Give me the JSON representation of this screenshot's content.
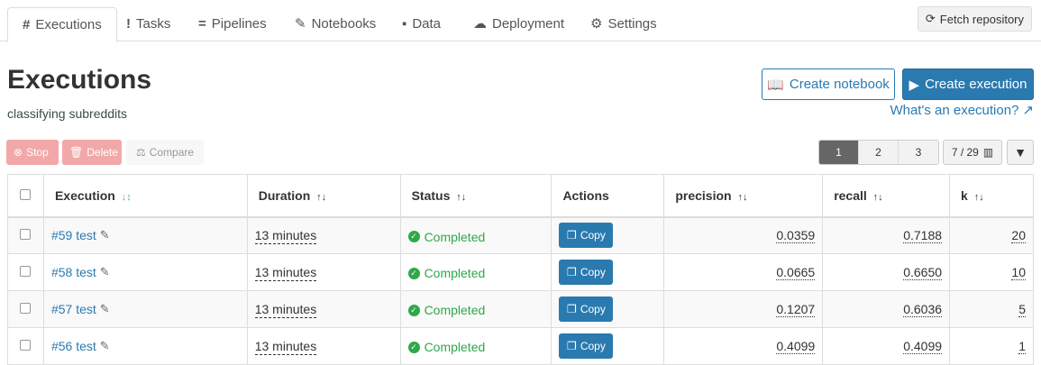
{
  "tabs": [
    {
      "label": "Executions",
      "icon": "#"
    },
    {
      "label": "Tasks",
      "icon": "!"
    },
    {
      "label": "Pipelines",
      "icon": "="
    },
    {
      "label": "Notebooks",
      "icon": "✎"
    },
    {
      "label": "Data",
      "icon": "▪"
    },
    {
      "label": "Deployment",
      "icon": "☁"
    },
    {
      "label": "Settings",
      "icon": "⚙"
    }
  ],
  "fetch_label": "Fetch repository",
  "page": {
    "title": "Executions",
    "subtitle": "classifying subreddits"
  },
  "actions": {
    "create_notebook": "Create notebook",
    "create_execution": "Create execution",
    "help": "What's an execution?"
  },
  "toolbar": {
    "stop": "Stop",
    "delete": "Delete",
    "compare": "Compare"
  },
  "pagination": {
    "pages": [
      "1",
      "2",
      "3"
    ],
    "active": "1",
    "columns": "7 / 29"
  },
  "table": {
    "headers": [
      "Execution",
      "Duration",
      "Status",
      "Actions",
      "precision",
      "recall",
      "k"
    ],
    "rows": [
      {
        "execution": "#59 test",
        "duration": "13 minutes",
        "status": "Completed",
        "action": "Copy",
        "precision": "0.0359",
        "recall": "0.7188",
        "k": "20"
      },
      {
        "execution": "#58 test",
        "duration": "13 minutes",
        "status": "Completed",
        "action": "Copy",
        "precision": "0.0665",
        "recall": "0.6650",
        "k": "10"
      },
      {
        "execution": "#57 test",
        "duration": "13 minutes",
        "status": "Completed",
        "action": "Copy",
        "precision": "0.1207",
        "recall": "0.6036",
        "k": "5"
      },
      {
        "execution": "#56 test",
        "duration": "13 minutes",
        "status": "Completed",
        "action": "Copy",
        "precision": "0.4099",
        "recall": "0.4099",
        "k": "1"
      }
    ]
  },
  "colors": {
    "primary": "#2a7ab0",
    "success": "#2ea84a",
    "danger_disabled": "#f2a8a8"
  }
}
